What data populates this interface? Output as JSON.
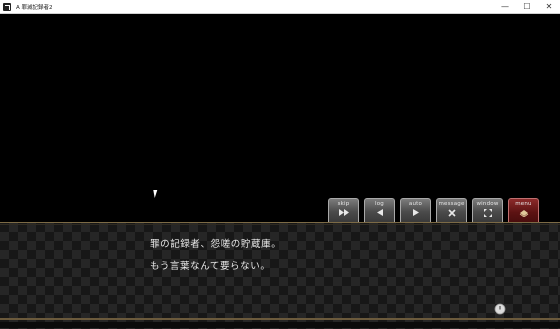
{
  "window": {
    "title": "A 罪滅記録者2",
    "controls": {
      "minimize": "—",
      "maximize": "☐",
      "close": "✕"
    }
  },
  "controls": [
    {
      "id": "skip",
      "label": "skip",
      "icon": "fast-forward-icon"
    },
    {
      "id": "log",
      "label": "log",
      "icon": "back-arrow-icon"
    },
    {
      "id": "auto",
      "label": "auto",
      "icon": "play-icon"
    },
    {
      "id": "message",
      "label": "message",
      "icon": "close-x-icon"
    },
    {
      "id": "window",
      "label": "window",
      "icon": "expand-icon"
    },
    {
      "id": "menu",
      "label": "menu",
      "icon": "book-icon"
    }
  ],
  "message": {
    "lines": [
      "罪の記録者、怨嗟の貯蔵庫。",
      "もう言葉なんて要らない。"
    ]
  },
  "colors": {
    "menu_button": "#6b1717",
    "button": "#5a5a5a",
    "frame_gold": "#7c6a45"
  }
}
